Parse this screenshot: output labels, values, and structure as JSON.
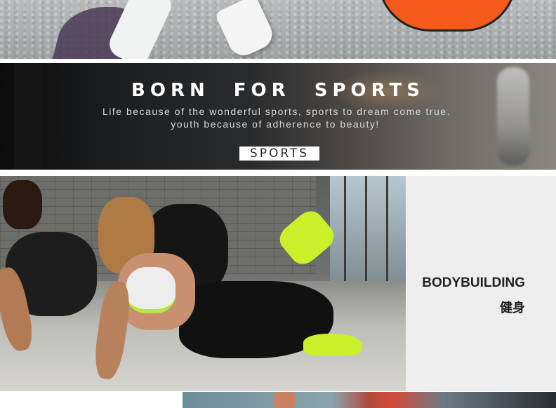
{
  "banner": {
    "title": "BORN FOR SPORTS",
    "line1": "Life because of the wonderful sports, sports to dream come true.",
    "line2": "youth because of adherence to beauty!",
    "badge": "SPORTS"
  },
  "category": {
    "name_en": "BODYBUILDING",
    "name_zh": "健身"
  },
  "colors": {
    "accent_orange": "#f35a1c",
    "neon_green": "#c9f02b",
    "panel_bg": "#eeeeee"
  }
}
